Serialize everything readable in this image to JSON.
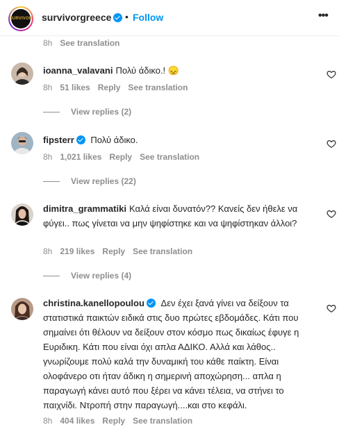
{
  "header": {
    "account": "survivorgreece",
    "avatar_text": "SURVIVOR",
    "dot": "•",
    "follow_label": "Follow",
    "more_icon": "more-horizontal-icon"
  },
  "partial_meta": {
    "time": "8h",
    "translation": "See translation"
  },
  "comments": [
    {
      "username": "ioanna_valavani",
      "text": "Πολύ άδικο.! 😞",
      "time": "8h",
      "likes": "51 likes",
      "reply": "Reply",
      "translation": "See translation",
      "view_replies": "View replies (2)"
    },
    {
      "username": "fipsterr",
      "verified": true,
      "text": "Πολύ άδικο.",
      "time": "8h",
      "likes": "1,021 likes",
      "reply": "Reply",
      "translation": "See translation",
      "view_replies": "View replies (22)"
    },
    {
      "username": "dimitra_grammatiki",
      "text": "Καλά είναι δυνατόν?? Κανείς δεν ήθελε να φύγει.. πως γίνεται να μην ψηφίστηκε και να ψηφίστηκαν άλλοι?",
      "time": "8h",
      "likes": "219 likes",
      "reply": "Reply",
      "translation": "See translation",
      "view_replies": "View replies (4)"
    },
    {
      "username": "christina.kanellopoulou",
      "verified": true,
      "text": "Δεν έχει ξανά γίνει να δείξουν τα στατιστικά παικτών ειδικά στις δυο πρώτες εβδομάδες. Κάτι που σημαίνει ότι θέλουν να δείξουν στον κόσμο πως δικαίως έφυγε η Ευριδικη. Κάτι που είναι όχι απλα ΑΔΙΚΟ. Αλλά και λάθος.. γνωρίζουμε πολύ καλά την δυναμική του κάθε παίκτη. Είναι ολοφάνερο οτι ήταν άδικη η σημερινή αποχώρηση... απλα η παραγωγή κάνει αυτό που ξέρει να κάνει τέλεια, να στήνει το παιχνίδι. Ντροπή στην παραγωγή....και στο κεφάλι.",
      "time": "8h",
      "likes": "404 likes",
      "reply": "Reply",
      "translation": "See translation"
    }
  ],
  "colors": {
    "accent": "#0095f6",
    "muted": "#8e8e8e",
    "text": "#262626"
  }
}
